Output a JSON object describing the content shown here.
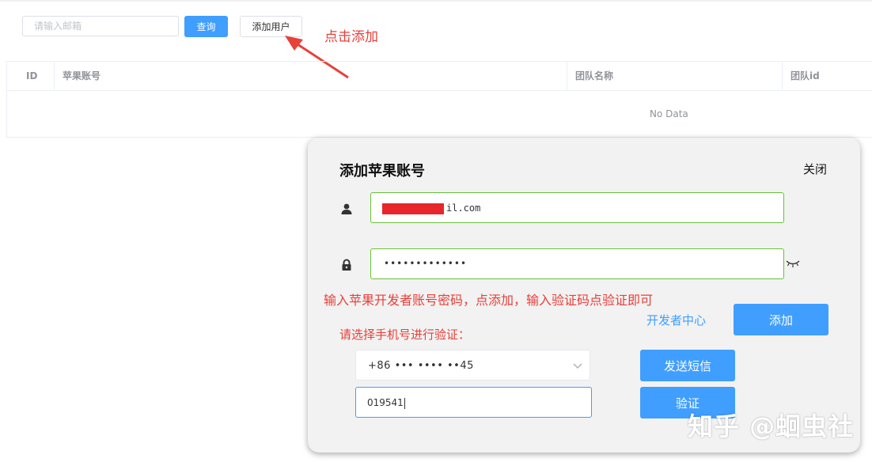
{
  "toolbar": {
    "search_placeholder": "请输入邮箱",
    "query_label": "查询",
    "add_user_label": "添加用户"
  },
  "annotations": {
    "click_add": "点击添加",
    "instruction": "输入苹果开发者账号密码，点添加，输入验证码点验证即可"
  },
  "table": {
    "columns": [
      "ID",
      "苹果账号",
      "团队名称",
      "团队id"
    ],
    "empty_text": "No Data"
  },
  "dialog": {
    "title": "添加苹果账号",
    "close_label": "关闭",
    "account_value_suffix": "il.com",
    "password_mask": "•••••••••••••",
    "dev_center_link": "开发者中心",
    "add_label": "添加",
    "phone_prompt": "请选择手机号进行验证：",
    "phone_selected": "+86 ••• •••• ••45",
    "send_sms_label": "发送短信",
    "code_value": "019541",
    "verify_label": "验证"
  },
  "watermark": "知乎 @蛔虫社",
  "colors": {
    "primary": "#409eff",
    "annotation_red": "#e8403a",
    "valid_border": "#67c23a"
  },
  "icons": [
    "user-icon",
    "lock-icon",
    "eye-closed-icon",
    "chevron-down-icon"
  ]
}
